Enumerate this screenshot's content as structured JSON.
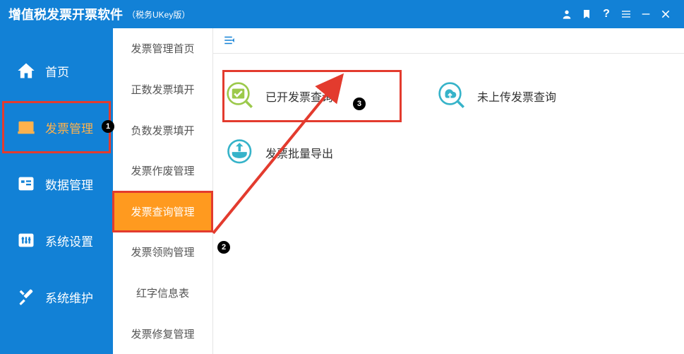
{
  "titlebar": {
    "title": "增值税发票开票软件",
    "subtitle": "（税务UKey版）"
  },
  "sidebar": {
    "items": [
      {
        "label": "首页"
      },
      {
        "label": "发票管理"
      },
      {
        "label": "数据管理"
      },
      {
        "label": "系统设置"
      },
      {
        "label": "系统维护"
      }
    ]
  },
  "submenu": {
    "items": [
      {
        "label": "发票管理首页"
      },
      {
        "label": "正数发票填开"
      },
      {
        "label": "负数发票填开"
      },
      {
        "label": "发票作废管理"
      },
      {
        "label": "发票查询管理"
      },
      {
        "label": "发票领购管理"
      },
      {
        "label": "红字信息表"
      },
      {
        "label": "发票修复管理"
      }
    ]
  },
  "tiles": [
    {
      "label": "已开发票查询"
    },
    {
      "label": "未上传发票查询"
    },
    {
      "label": "发票批量导出"
    }
  ],
  "badges": {
    "one": "1",
    "two": "2",
    "three": "3"
  }
}
